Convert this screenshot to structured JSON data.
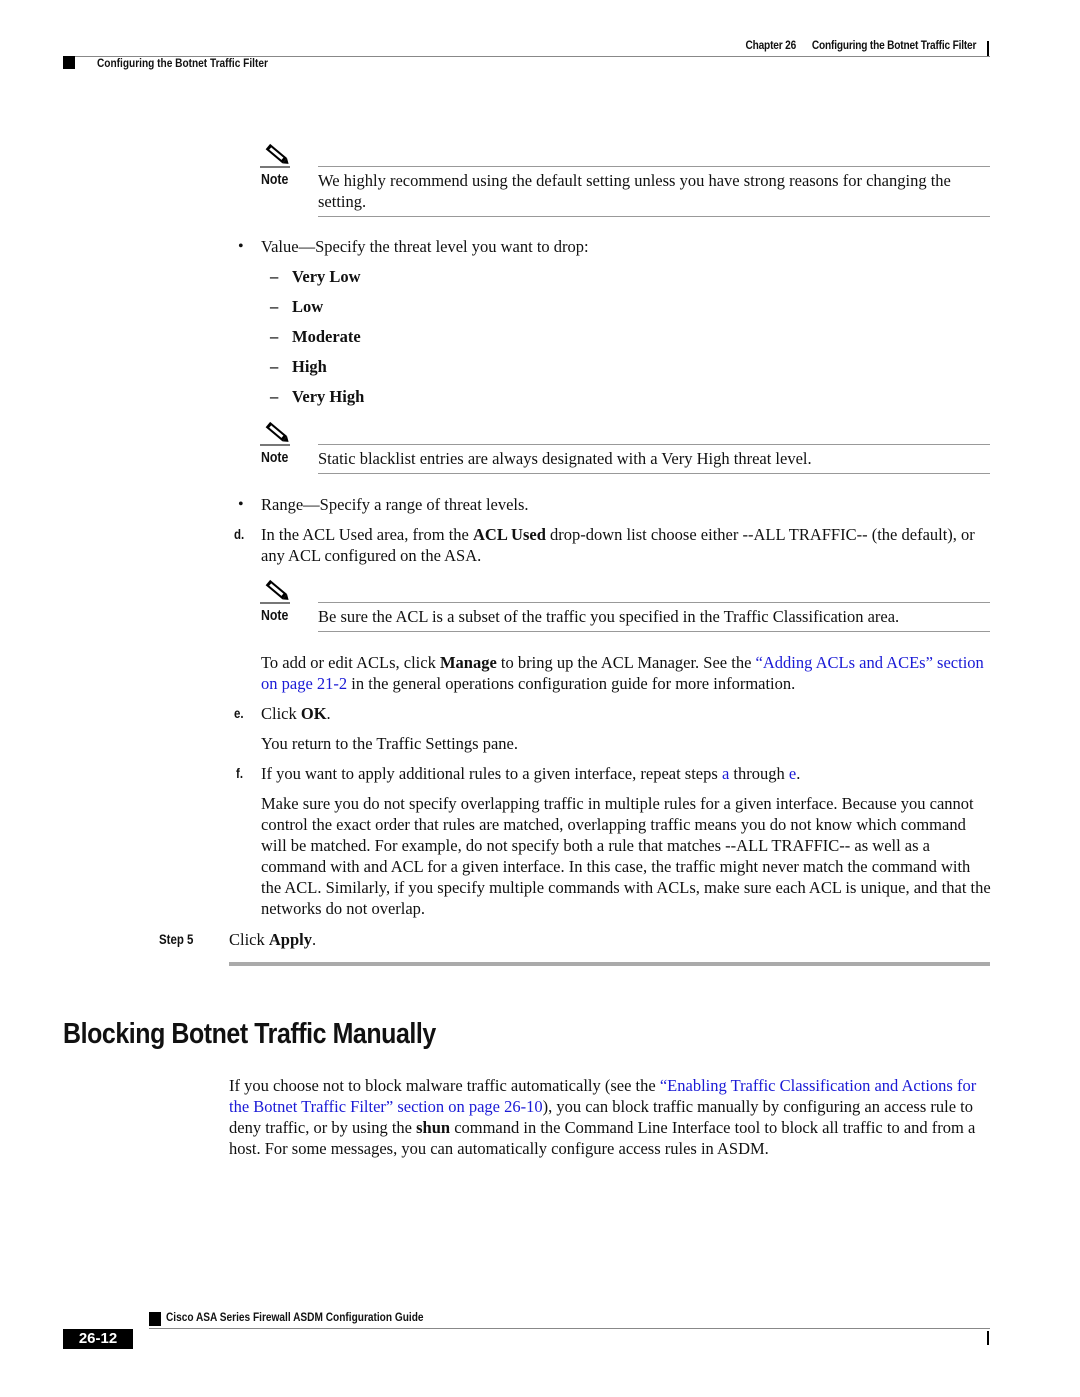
{
  "header": {
    "chapter_label": "Chapter 26",
    "chapter_title": "Configuring the Botnet Traffic Filter",
    "section_title": "Configuring the Botnet Traffic Filter"
  },
  "note_label": "Note",
  "notes": [
    {
      "text": "We highly recommend using the default setting unless you have strong reasons for changing the setting."
    },
    {
      "text": "Static blacklist entries are always designated with a Very High threat level."
    },
    {
      "text": "Be sure the ACL is a subset of the traffic you specified in the Traffic Classification area."
    }
  ],
  "value_bullet": {
    "bullet": "•",
    "text": "Value—Specify the threat level you want to drop:"
  },
  "threat_levels": [
    {
      "dash": "–",
      "label": "Very Low"
    },
    {
      "dash": "–",
      "label": "Low"
    },
    {
      "dash": "–",
      "label": "Moderate"
    },
    {
      "dash": "–",
      "label": "High"
    },
    {
      "dash": "–",
      "label": "Very High"
    }
  ],
  "range_bullet": {
    "bullet": "•",
    "text": "Range—Specify a range of threat levels."
  },
  "step_d": {
    "letter": "d.",
    "pre": "In the ACL Used area, from the ",
    "bold": "ACL Used",
    "post": " drop-down list choose either --ALL TRAFFIC-- (the default), or any ACL configured on the ASA."
  },
  "acl_para": {
    "pre": "To add or edit ACLs, click ",
    "bold": "Manage",
    "mid": " to bring up the ACL Manager. See the ",
    "link": "“Adding ACLs and ACEs” section on page 21-2",
    "post": " in the general operations configuration guide for more information."
  },
  "step_e": {
    "letter": "e.",
    "pre": "Click ",
    "bold": "OK",
    "post": ".",
    "result": "You return to the Traffic Settings pane."
  },
  "step_f": {
    "letter": "f.",
    "pre": "If you want to apply additional rules to a given interface, repeat steps ",
    "link_a": "a",
    "mid": " through ",
    "link_e": "e",
    "post": ".",
    "para": "Make sure you do not specify overlapping traffic in multiple rules for a given interface. Because you cannot control the exact order that rules are matched, overlapping traffic means you do not know which command will be matched. For example, do not specify both a rule that matches --ALL TRAFFIC-- as well as a command with and ACL for a given interface. In this case, the traffic might never match the command with the ACL. Similarly, if you specify multiple commands with ACLs, make sure each ACL is unique, and that the networks do not overlap."
  },
  "step5": {
    "label": "Step 5",
    "pre": "Click ",
    "bold": "Apply",
    "post": "."
  },
  "section": {
    "title": "Blocking Botnet Traffic Manually",
    "pre": "If you choose not to block malware traffic automatically (see the ",
    "link": "“Enabling Traffic Classification and Actions for the Botnet Traffic Filter” section on page 26-10",
    "mid": "), you can block traffic manually by configuring an access rule to deny traffic, or by using the ",
    "bold": "shun",
    "post": " command in the Command Line Interface tool to block all traffic to and from a host. For some messages, you can automatically configure access rules in ASDM."
  },
  "footer": {
    "guide_title": "Cisco ASA Series Firewall ASDM Configuration Guide",
    "page_number": "26-12"
  },
  "colors": {
    "link": "#1a1ad6",
    "rule": "#999999"
  }
}
